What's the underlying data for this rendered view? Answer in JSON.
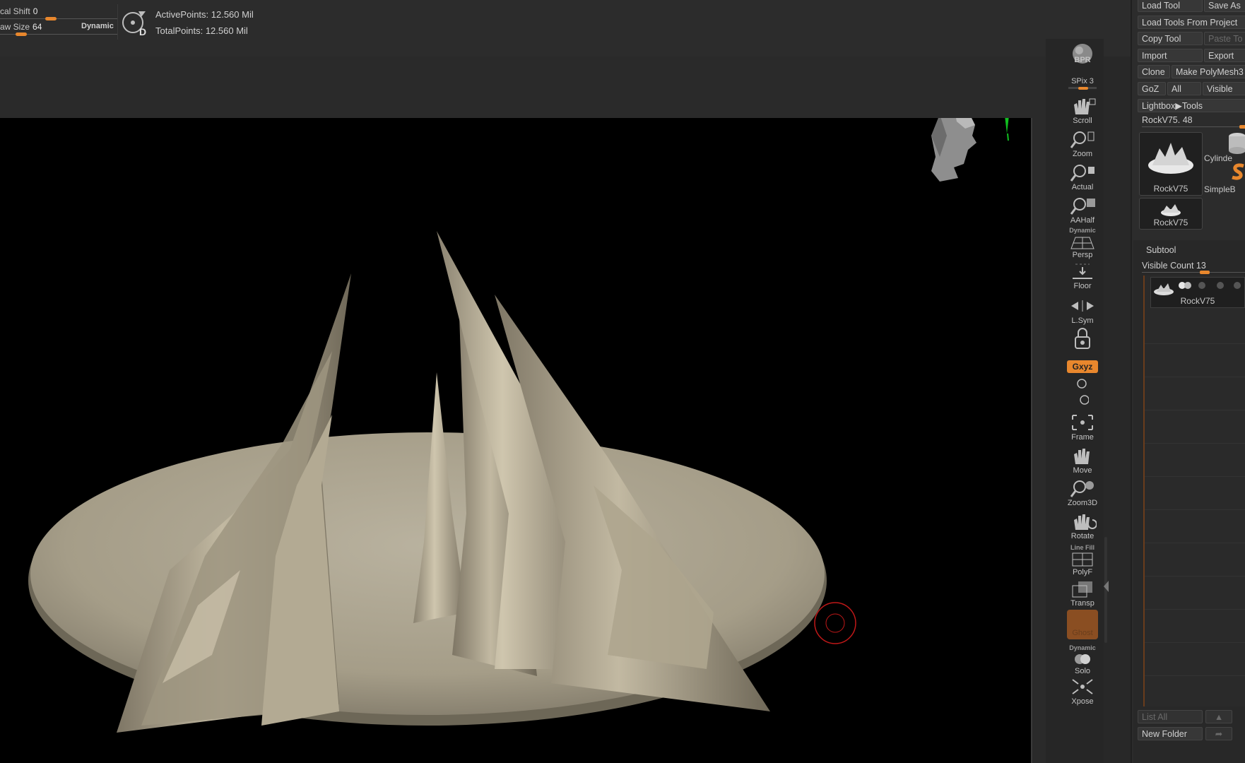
{
  "top_bar": {
    "focal_shift_label": "cal Shift",
    "focal_shift_value": "0",
    "focal_shift_level": 0.4,
    "draw_size_label": "aw Size",
    "draw_size_value": "64",
    "draw_size_level": 0.15,
    "dynamic_label": "Dynamic",
    "d_icon_letter": "D",
    "active_points": "ActivePoints: 12.560 Mil",
    "total_points": "TotalPoints: 12.560 Mil"
  },
  "right_shelf": {
    "bpr": "BPR",
    "spix_label": "SPix",
    "spix_value": "3",
    "spix_level": 0.5,
    "scroll": "Scroll",
    "zoom": "Zoom",
    "actual": "Actual",
    "aahalf": "AAHalf",
    "dynamic_small": "Dynamic",
    "persp": "Persp",
    "floor": "Floor",
    "lsym": "L.Sym",
    "xyz": "Gxyz",
    "frame": "Frame",
    "move": "Move",
    "zoom3d": "Zoom3D",
    "rotate": "Rotate",
    "line_fill": "Line Fill",
    "polyf": "PolyF",
    "transp": "Transp",
    "ghost": "Ghost",
    "dynamic_small_2": "Dynamic",
    "solo": "Solo",
    "xpose": "Xpose"
  },
  "tool_palette": {
    "load_tool": "Load Tool",
    "save_as": "Save As",
    "load_tools_from_project": "Load Tools From Project",
    "copy_tool": "Copy Tool",
    "paste_tool": "Paste To",
    "import": "Import",
    "export": "Export",
    "clone": "Clone",
    "make_polymesh": "Make PolyMesh3",
    "goz": "GoZ",
    "all": "All",
    "visible": "Visible",
    "lightbox_tools": "Lightbox▶Tools",
    "current_tool_label": "RockV75.",
    "current_tool_value": "48",
    "thumb1": "RockV75",
    "thumb2": "Cylinde",
    "thumb3": "SimpleB",
    "thumb4": "RockV75"
  },
  "subtool": {
    "header": "Subtool",
    "visible_count_label": "Visible Count",
    "visible_count_value": "13",
    "visible_count_level": 0.55,
    "item1": "RockV75",
    "list_all": "List All",
    "new_folder": "New Folder"
  },
  "colors": {
    "accent_orange": "#e8872d",
    "gizmo_red": "#ff1010",
    "gizmo_green": "#10c020",
    "gizmo_blue": "#1010ff",
    "rock_color": "#b5ac96"
  }
}
